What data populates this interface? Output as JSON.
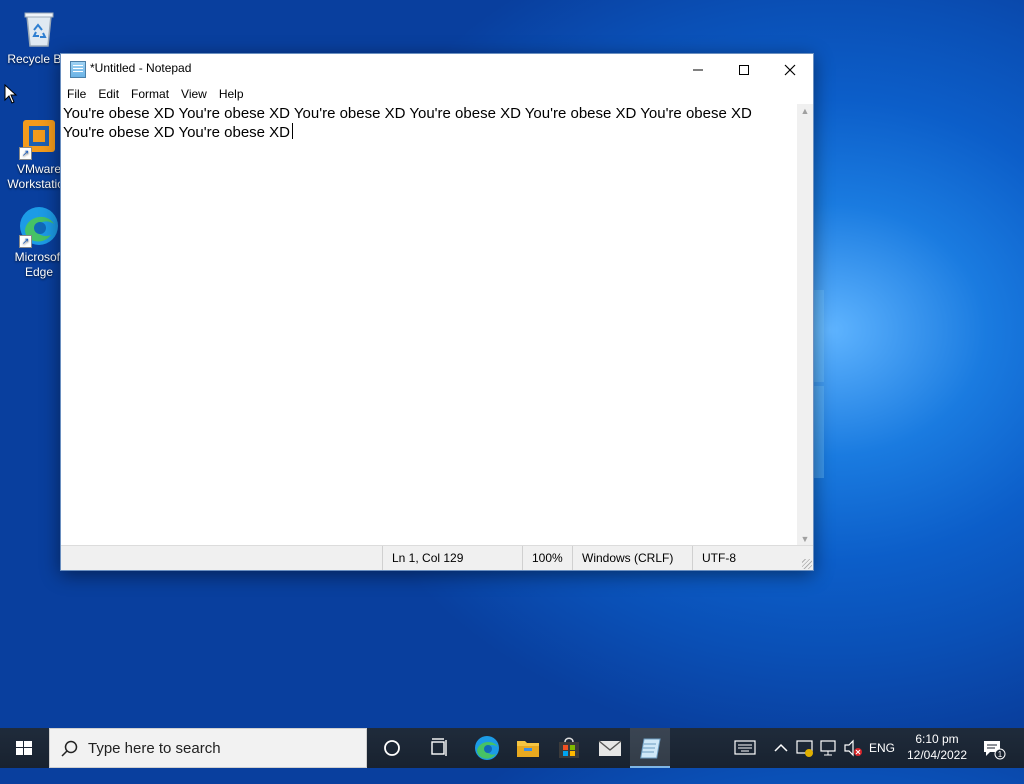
{
  "desktop": {
    "icons": [
      {
        "label": "Recycle Bin",
        "icon": "recycle-bin-icon"
      },
      {
        "label": "VMware Workstation",
        "icon": "vmware-icon"
      },
      {
        "label": "Microsoft Edge",
        "icon": "edge-icon"
      }
    ]
  },
  "window": {
    "title": "*Untitled - Notepad",
    "controls": {
      "minimize": "—",
      "maximize": "☐",
      "close": "✕"
    },
    "menu": [
      "File",
      "Edit",
      "Format",
      "View",
      "Help"
    ],
    "content": "You're obese XD You're obese XD You're obese XD You're obese XD You're obese XD You're obese XD You're obese XD You're obese XD",
    "status": {
      "position": "Ln 1, Col 129",
      "zoom": "100%",
      "line_ending": "Windows (CRLF)",
      "encoding": "UTF-8"
    }
  },
  "taskbar": {
    "search_placeholder": "Type here to search",
    "pinned": [
      "cortana-icon",
      "task-view-icon",
      "edge-icon",
      "file-explorer-icon",
      "store-icon",
      "mail-icon",
      "notepad-icon"
    ],
    "tray": {
      "language": "ENG",
      "time": "6:10 pm",
      "date": "12/04/2022",
      "notification_count": "1"
    }
  },
  "colors": {
    "desktop_blue": "#0c5ec9",
    "taskbar": "#1c2838",
    "active_indicator": "#7fb6e6"
  }
}
